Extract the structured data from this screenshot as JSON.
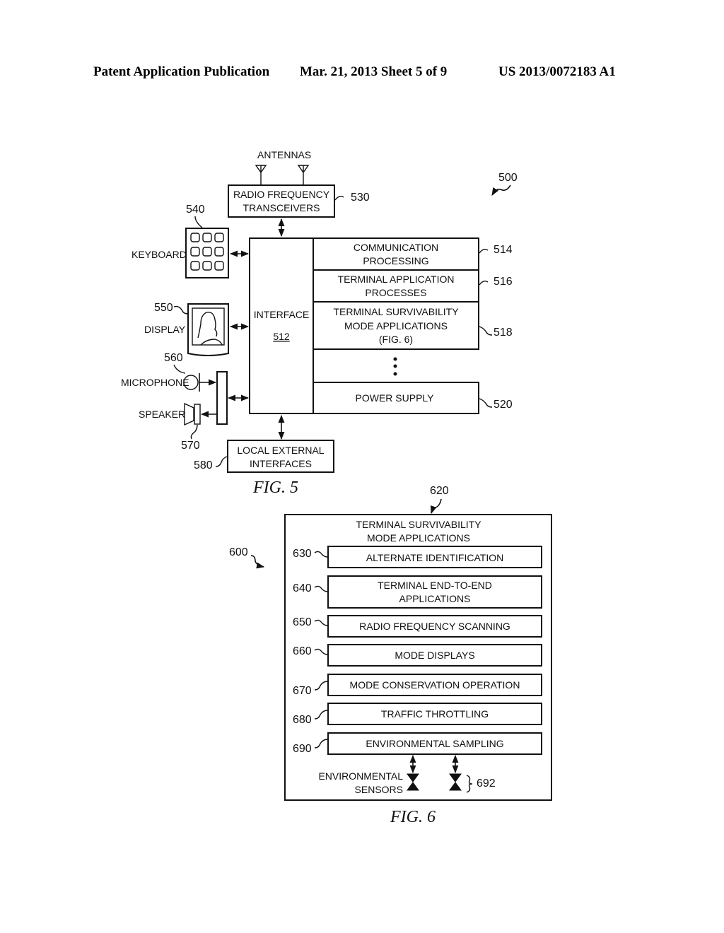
{
  "header": {
    "publication": "Patent Application Publication",
    "date_sheet": "Mar. 21, 2013  Sheet 5 of 9",
    "pub_number": "US 2013/0072183 A1"
  },
  "fig5": {
    "caption": "FIG. 5",
    "ref": "500",
    "antennas_label": "ANTENNAS",
    "rf_transceivers": {
      "line1": "RADIO FREQUENCY",
      "line2": "TRANSCEIVERS",
      "ref": "530"
    },
    "keyboard": {
      "label": "KEYBOARD",
      "ref": "540"
    },
    "display": {
      "label": "DISPLAY",
      "ref": "550"
    },
    "microphone": {
      "label": "MICROPHONE",
      "ref": "560"
    },
    "speaker": {
      "label": "SPEAKER",
      "ref": "570"
    },
    "local_external": {
      "line1": "LOCAL EXTERNAL",
      "line2": "INTERFACES",
      "ref": "580"
    },
    "interface": {
      "label": "INTERFACE",
      "ref": "512"
    },
    "blocks": [
      {
        "line1": "COMMUNICATION",
        "line2": "PROCESSING",
        "line3": "",
        "ref": "514"
      },
      {
        "line1": "TERMINAL APPLICATION",
        "line2": "PROCESSES",
        "line3": "",
        "ref": "516"
      },
      {
        "line1": "TERMINAL SURVIVABILITY",
        "line2": "MODE APPLICATIONS",
        "line3": "(FIG. 6)",
        "ref": "518"
      },
      {
        "line1": "POWER SUPPLY",
        "line2": "",
        "line3": "",
        "ref": "520"
      }
    ]
  },
  "fig6": {
    "caption": "FIG. 6",
    "ref": "600",
    "container_ref": "620",
    "title_line1": "TERMINAL SURVIVABILITY",
    "title_line2": "MODE APPLICATIONS",
    "items": [
      {
        "line1": "ALTERNATE IDENTIFICATION",
        "line2": "",
        "ref": "630"
      },
      {
        "line1": "TERMINAL END-TO-END",
        "line2": "APPLICATIONS",
        "ref": "640"
      },
      {
        "line1": "RADIO FREQUENCY SCANNING",
        "line2": "",
        "ref": "650"
      },
      {
        "line1": "MODE DISPLAYS",
        "line2": "",
        "ref": "660"
      },
      {
        "line1": "MODE CONSERVATION OPERATION",
        "line2": "",
        "ref": "670"
      },
      {
        "line1": "TRAFFIC THROTTLING",
        "line2": "",
        "ref": "680"
      },
      {
        "line1": "ENVIRONMENTAL SAMPLING",
        "line2": "",
        "ref": "690"
      }
    ],
    "sensors": {
      "line1": "ENVIRONMENTAL",
      "line2": "SENSORS",
      "ref": "692"
    }
  }
}
